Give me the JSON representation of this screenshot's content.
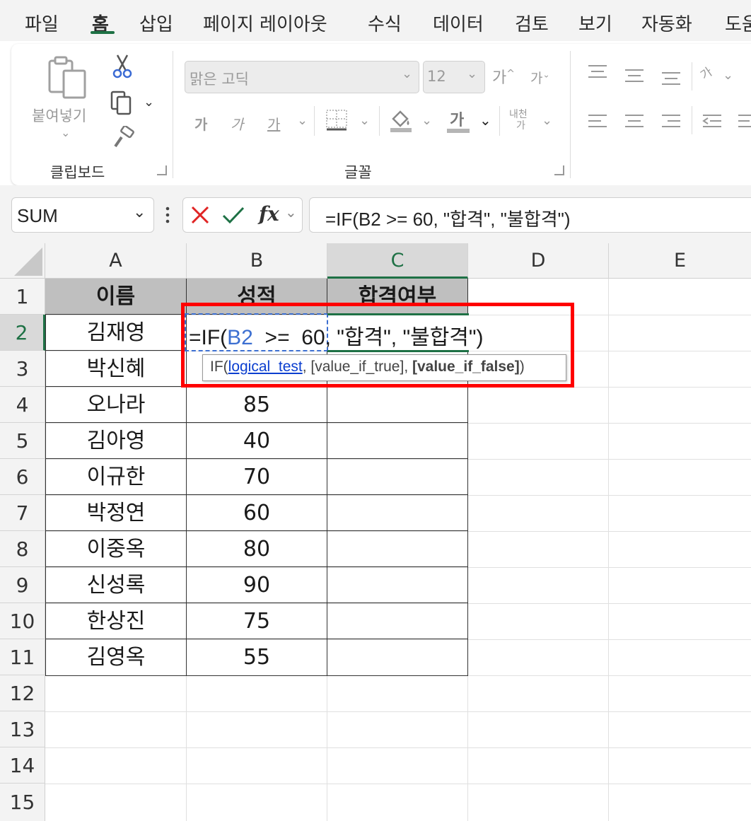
{
  "menu": {
    "tabs": [
      "파일",
      "홈",
      "삽입",
      "페이지 레이아웃",
      "수식",
      "데이터",
      "검토",
      "보기",
      "자동화",
      "도움"
    ],
    "active_tab": "홈"
  },
  "ribbon": {
    "clipboard": {
      "paste_label": "붙여넣기",
      "group_label": "클립보드"
    },
    "font": {
      "font_name": "맑은 고딕",
      "font_size": "12",
      "grow_label": "가",
      "shrink_label": "가",
      "bold_label": "가",
      "italic_label": "가",
      "underline_label": "가",
      "font_color_label": "가",
      "phonetic_label_1": "내천",
      "phonetic_label_2": "가",
      "group_label": "글꼴"
    },
    "alignment": {
      "orient_label": "가"
    }
  },
  "formula_bar": {
    "name_box": "SUM",
    "fx": "fx",
    "formula": "=IF(B2  >=  60, \"합격\", \"불합격\")"
  },
  "grid": {
    "columns": [
      "A",
      "B",
      "C",
      "D",
      "E"
    ],
    "rows": [
      "1",
      "2",
      "3",
      "4",
      "5",
      "6",
      "7",
      "8",
      "9",
      "10",
      "11",
      "12",
      "13",
      "14",
      "15"
    ],
    "header": {
      "name": "이름",
      "score": "성적",
      "result": "합격여부"
    },
    "data": [
      {
        "name": "김재영",
        "score": ""
      },
      {
        "name": "박신혜",
        "score": ""
      },
      {
        "name": "오나라",
        "score": "85"
      },
      {
        "name": "김아영",
        "score": "40"
      },
      {
        "name": "이규한",
        "score": "70"
      },
      {
        "name": "박정연",
        "score": "60"
      },
      {
        "name": "이중옥",
        "score": "80"
      },
      {
        "name": "신성록",
        "score": "90"
      },
      {
        "name": "한상진",
        "score": "75"
      },
      {
        "name": "김영옥",
        "score": "55"
      }
    ]
  },
  "editing": {
    "prefix": "=IF(",
    "ref": "B2",
    "rest": "  >=  60, \"합격\", \"불합격\")",
    "tooltip": {
      "fn": "IF(",
      "arg1": "logical_test",
      "sep1": ", ",
      "arg2": "[value_if_true]",
      "sep2": ", ",
      "arg3": "[value_if_false]",
      "close": ")"
    }
  },
  "colors": {
    "accent_green": "#1e7145",
    "ref_blue": "#3c6fd1",
    "highlight_red": "#ff0000",
    "header_fill": "#bfbfbf"
  }
}
